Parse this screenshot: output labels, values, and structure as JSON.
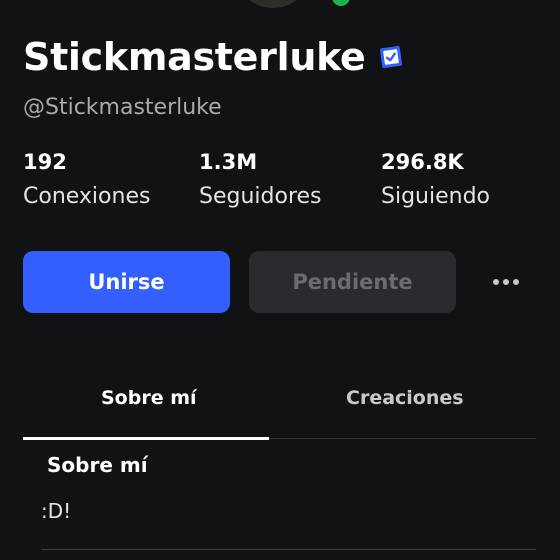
{
  "profile": {
    "display_name": "Stickmasterluke",
    "username": "@Stickmasterluke",
    "verified": true,
    "online_status_color": "#21b04f"
  },
  "stats": [
    {
      "value": "192",
      "label": "Conexiones"
    },
    {
      "value": "1.3M",
      "label": "Seguidores"
    },
    {
      "value": "296.8K",
      "label": "Siguiendo"
    }
  ],
  "actions": {
    "join_label": "Unirse",
    "join_color": "#335fff",
    "pending_label": "Pendiente",
    "more_icon": "more-horizontal-icon"
  },
  "tabs": [
    {
      "label": "Sobre mí",
      "active": true
    },
    {
      "label": "Creaciones",
      "active": false
    }
  ],
  "about": {
    "title": "Sobre mí",
    "text": ":D!"
  }
}
